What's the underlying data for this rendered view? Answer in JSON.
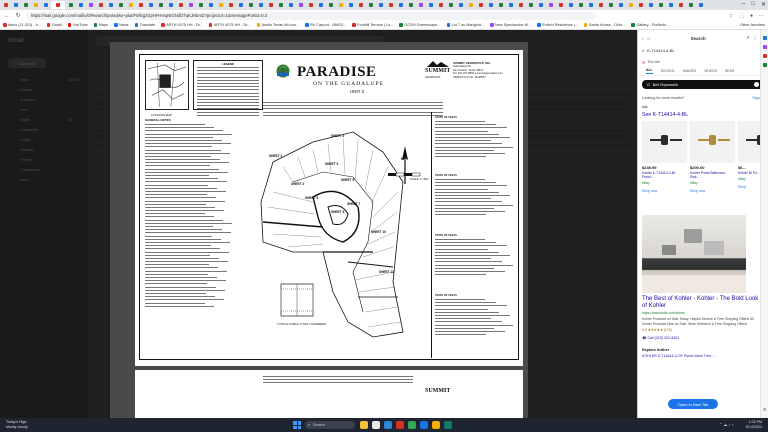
{
  "browser": {
    "url": "https://mail.google.com/mail/u/0/#search/paradise+plat/FMfcgzGpHFHmqNtGNdfJTqKJNbmZ?projector=1&messagePartId=0.3",
    "tab_colors": [
      "#d93025",
      "#1a73e8",
      "#188038",
      "#f9ab00",
      "#1a73e8",
      "#d93025",
      "#188038",
      "#1a73e8",
      "#a142f4",
      "#d93025",
      "#1a73e8",
      "#188038",
      "#f9ab00",
      "#d93025",
      "#1a73e8",
      "#188038",
      "#1a73e8",
      "#d93025",
      "#a142f4",
      "#188038",
      "#1a73e8",
      "#f9ab00",
      "#d93025",
      "#1a73e8",
      "#188038",
      "#1a73e8",
      "#d93025",
      "#188038",
      "#1a73e8",
      "#a142f4",
      "#d93025",
      "#1a73e8",
      "#188038",
      "#f9ab00",
      "#1a73e8",
      "#d93025",
      "#188038",
      "#1a73e8",
      "#d93025",
      "#1a73e8",
      "#188038",
      "#a142f4",
      "#1a73e8",
      "#d93025",
      "#188038",
      "#1a73e8",
      "#f9ab00",
      "#d93025",
      "#1a73e8",
      "#188038",
      "#1a73e8",
      "#d93025",
      "#188038",
      "#1a73e8",
      "#a142f4",
      "#d93025",
      "#1a73e8",
      "#188038",
      "#1a73e8",
      "#d93025",
      "#188038",
      "#1a73e8",
      "#f9ab00",
      "#d93025",
      "#1a73e8",
      "#188038",
      "#1a73e8",
      "#d93025",
      "#188038",
      "#1a73e8"
    ],
    "bookmarks": [
      {
        "label": "Inbox (11,313) - b...",
        "color": "#d93025"
      },
      {
        "label": "Gmail",
        "color": "#d93025"
      },
      {
        "label": "YouTube",
        "color": "#ff0000"
      },
      {
        "label": "Maps",
        "color": "#188038"
      },
      {
        "label": "News",
        "color": "#1a73e8"
      },
      {
        "label": "Translate",
        "color": "#1a73e8"
      },
      {
        "label": "ARTH 4075 HH - Dr...",
        "color": "#d93025"
      },
      {
        "label": "ARTH 4075 HH - Dr...",
        "color": "#d93025"
      },
      {
        "label": "Austin Texas hill cou...",
        "color": "#f9ab00"
      },
      {
        "label": "RV Carport - 08603...",
        "color": "#1a73e8"
      },
      {
        "label": "Foothill Terrace | Lo...",
        "color": "#d93025"
      },
      {
        "label": "GOSH Greenscape...",
        "color": "#188038"
      },
      {
        "label": "Lot 7 on Marigold...",
        "color": "#1a73e8"
      },
      {
        "label": "New Spectacular M...",
        "color": "#a142f4"
      },
      {
        "label": "Enfield Residence |...",
        "color": "#1a73e8"
      },
      {
        "label": "Santa House - Ortiz...",
        "color": "#f9ab00"
      },
      {
        "label": "Gallery - Portfolio...",
        "color": "#188038"
      }
    ],
    "other_favorites": "Other favorites"
  },
  "gmail": {
    "logo": "Gmail",
    "compose": "Compose",
    "nav": [
      {
        "label": "Inbox",
        "count": "11,313"
      },
      {
        "label": "Starred",
        "count": ""
      },
      {
        "label": "Snoozed",
        "count": ""
      },
      {
        "label": "Sent",
        "count": ""
      },
      {
        "label": "Drafts",
        "count": "24"
      },
      {
        "label": "Categories",
        "count": ""
      },
      {
        "label": "Social",
        "count": ""
      },
      {
        "label": "Updates",
        "count": ""
      },
      {
        "label": "Forums",
        "count": ""
      },
      {
        "label": "Promotions",
        "count": ""
      },
      {
        "label": "More",
        "count": ""
      }
    ]
  },
  "document": {
    "title": "PARADISE",
    "subtitle": "ON THE GUADALUPE",
    "unit": "UNIT 2",
    "firm": "SUMMIT",
    "firm_sub": "GEOMATICS",
    "firm_block_title": "SUMMIT GEOMATICS, INC.",
    "firm_block_lines": [
      "1016 Walnut Dr.",
      "San Antonio, Texas 78217",
      "Tel. 210-971-8878 ● summitgeomatics.com",
      "TBPELS Firm No. 10196057"
    ],
    "location_map": "LOCATION MAP",
    "legend": "LEGEND",
    "general_notes": "GENERAL NOTES",
    "sheets": [
      "SHEET 2",
      "SHEET 3",
      "SHEET 4",
      "SHEET 5",
      "SHEET 6",
      "SHEET 7",
      "SHEET 8",
      "SHEET 9",
      "SHEET 10",
      "SHEET 11"
    ],
    "scale": "SCALE: 1\"=600'",
    "north": "N",
    "typical": "TYPICAL PUBLIC UTILITY EASEMENT",
    "cert_titles": [
      "STATE OF TEXAS",
      "STATE OF TEXAS",
      "STATE OF TEXAS",
      "STATE OF TEXAS"
    ]
  },
  "sidebar": {
    "title": "Search",
    "query": "K-T14414-4-BL",
    "site_label": "This site",
    "tabs": [
      "ALL",
      "SCHOOL",
      "IMAGES",
      "VIDEOS",
      "SEAR"
    ],
    "account": "Bell Chynoweth",
    "work_prompt": "Looking for work results?",
    "sign_in": "Sign in",
    "ads_label": "Ads",
    "see_title": "See K-T14414-4-BL",
    "products": [
      {
        "price": "$249.99",
        "name": "Kohler K-T14414-4-BL Purist...",
        "store": "eBay",
        "shop": "Shop now",
        "tint": "#2b2b2b"
      },
      {
        "price": "$200.00",
        "name": "Kohler Purist Bathroom Sink...",
        "store": "eBay",
        "shop": "Shop now",
        "tint": "#b08a3e"
      },
      {
        "price": "$6...",
        "name": "Kohler Bl Pu...",
        "store": "eBay",
        "shop": "Shop",
        "tint": "#2b2b2b"
      }
    ],
    "ad2_title": "The Best of Kohler - Kohler - The Bold Look of Kohler",
    "ad2_url": "https://www.build.com/kohler",
    "ad2_desc": "Kohler Products on Sale Today. Helpful Service & Free Shipping Offers! All Kohler Products Now on Sale. Wide Selection & Free Shipping Offers!",
    "ad2_rating": "4.5 ★★★★★ (176)",
    "ad2_call": "Call (315) 322-8281",
    "explore": "Explore further",
    "explore_item": "KOHLER K-T14414-4-CP Purist Valve Trim,...",
    "open_new_tab": "Open in New Tab"
  },
  "taskbar": {
    "weather_line1": "Today's High",
    "weather_line2": "Mostly cloudy",
    "search": "Search",
    "time": "1:02 PM",
    "date": "6/14/2024",
    "app_colors": [
      "#f3c13a",
      "#e8e8e8",
      "#2b88d8",
      "#d93025",
      "#34a853",
      "#1a73e8",
      "#f9ab00",
      "#0f7b6c"
    ]
  }
}
